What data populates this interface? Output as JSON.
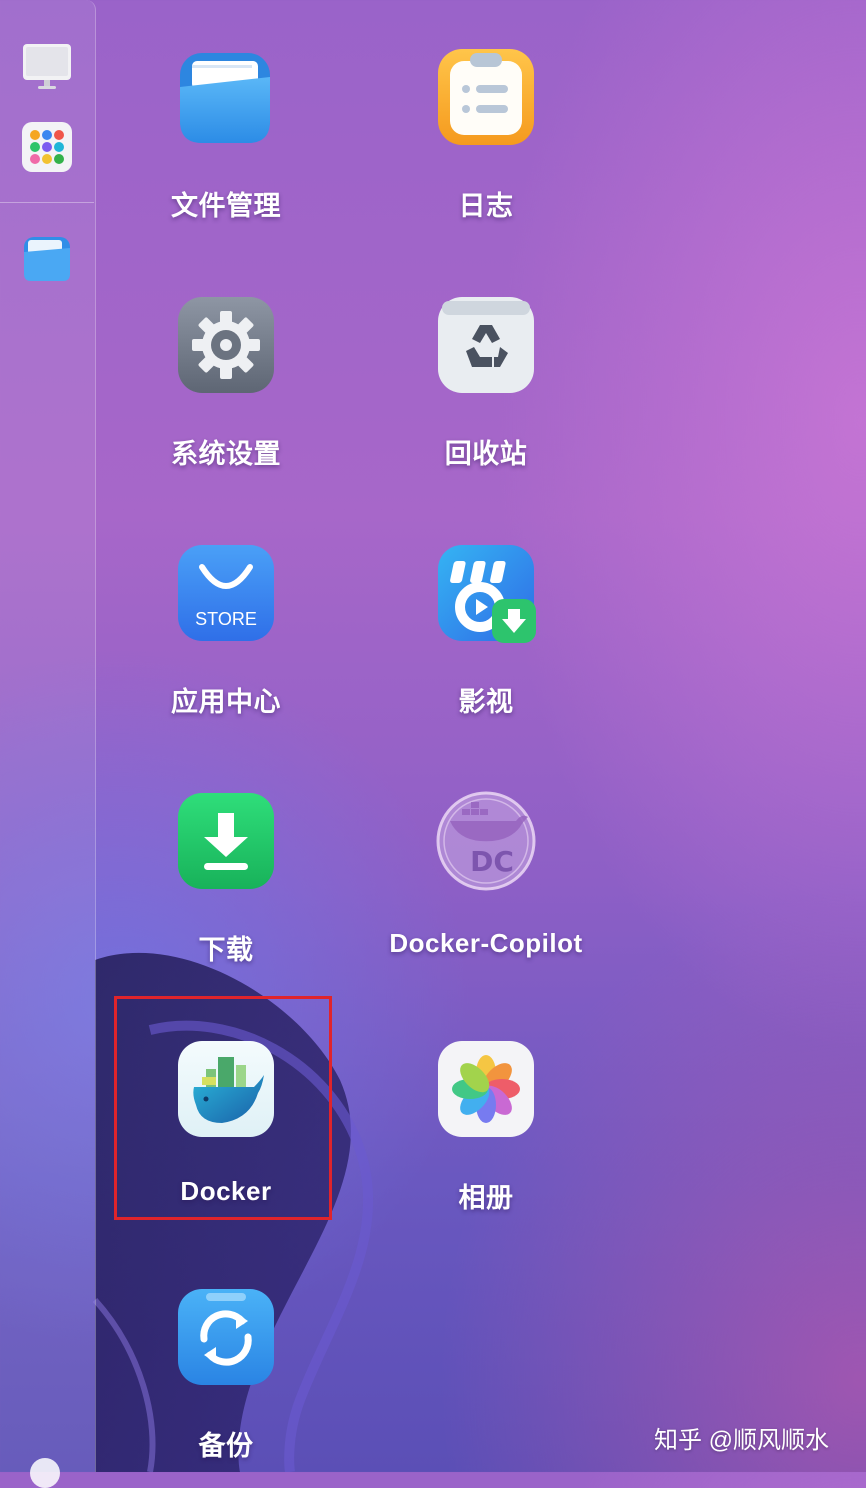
{
  "sidebar": {
    "items": [
      {
        "name": "monitor-icon"
      },
      {
        "name": "app-grid-icon"
      },
      {
        "name": "folder-icon"
      }
    ]
  },
  "apps": [
    {
      "label": "文件管理",
      "icon": "folder-icon"
    },
    {
      "label": "日志",
      "icon": "notepad-icon"
    },
    {
      "label": "系统设置",
      "icon": "gear-icon"
    },
    {
      "label": "回收站",
      "icon": "recycle-bin-icon"
    },
    {
      "label": "应用中心",
      "icon": "store-icon",
      "icon_text": "STORE"
    },
    {
      "label": "影视",
      "icon": "video-download-icon"
    },
    {
      "label": "下载",
      "icon": "download-icon"
    },
    {
      "label": "Docker-Copilot",
      "icon": "docker-copilot-icon",
      "icon_text": "DC"
    },
    {
      "label": "Docker",
      "icon": "docker-whale-icon",
      "highlighted": true
    },
    {
      "label": "相册",
      "icon": "photos-pinwheel-icon"
    },
    {
      "label": "备份",
      "icon": "backup-sync-icon"
    }
  ],
  "watermark": "知乎 @顺风顺水",
  "colors": {
    "highlight": "#e0242b",
    "download_green": "#22c86a",
    "store_blue": "#3a7df0",
    "folder_blue": "#3aa2f0"
  }
}
